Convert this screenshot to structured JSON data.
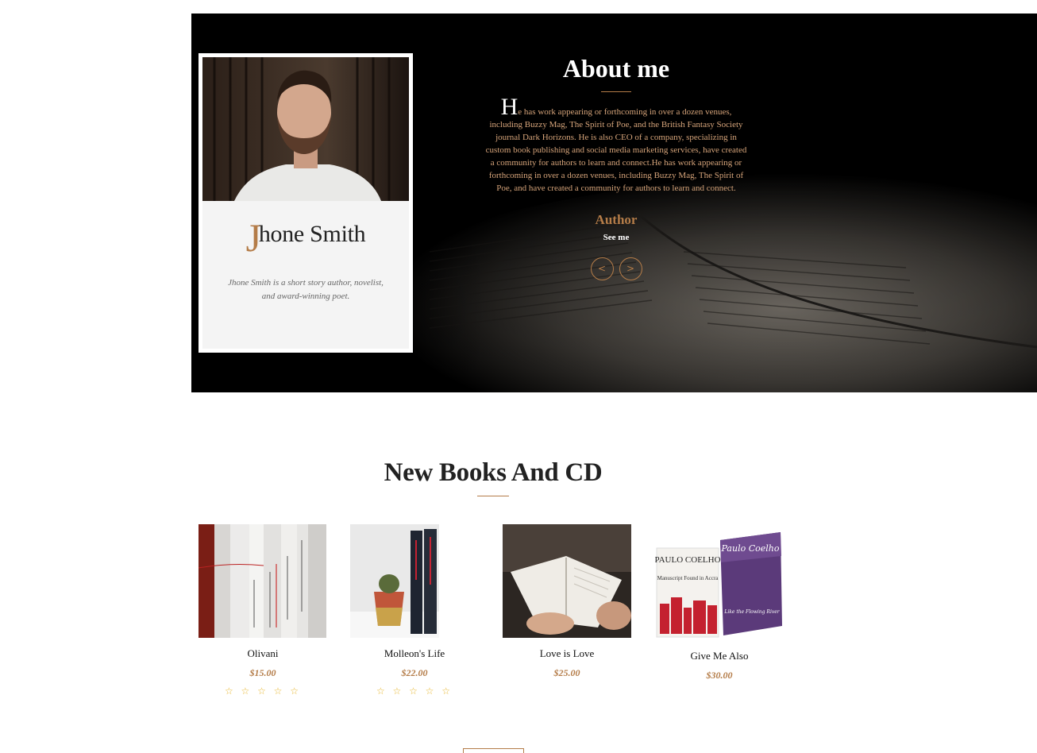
{
  "about": {
    "title": "About me",
    "drop_letter": "H",
    "text": "e has work appearing or forthcoming in over a dozen venues, including Buzzy Mag, The Spirit of Poe, and the British Fantasy Society journal Dark Horizons. He is also CEO of a company, specializing in custom book publishing and social media marketing services, have created a community for authors to learn and connect.He has work appearing or forthcoming in over a dozen venues, including Buzzy Mag, The Spirit of Poe, and have created a community for authors to learn and connect.",
    "role": "Author",
    "see_me": "See me",
    "prev_label": "<",
    "next_label": ">"
  },
  "profile": {
    "name_initial": "J",
    "name_rest": "hone Smith",
    "bio": "Jhone Smith is a short story author, novelist, and award-winning poet."
  },
  "books_section": {
    "title": "New Books And CD",
    "items": [
      {
        "title": "Olivani",
        "price": "$15.00",
        "rating": "☆ ☆ ☆ ☆ ☆"
      },
      {
        "title": "Molleon's Life",
        "price": "$22.00",
        "rating": "☆ ☆ ☆ ☆ ☆"
      },
      {
        "title": "Love is Love",
        "price": "$25.00"
      },
      {
        "title": "Give Me Also",
        "price": "$30.00",
        "cover_author": "PAULO COELHO",
        "cover_subtitle": "Manuscript Found in Accra",
        "cover_script": "Paulo Coelho",
        "cover_title2": "Like the Flowing River"
      }
    ]
  },
  "colors": {
    "accent": "#b47c48",
    "hero_bg": "#000000",
    "star": "#e8b730"
  }
}
